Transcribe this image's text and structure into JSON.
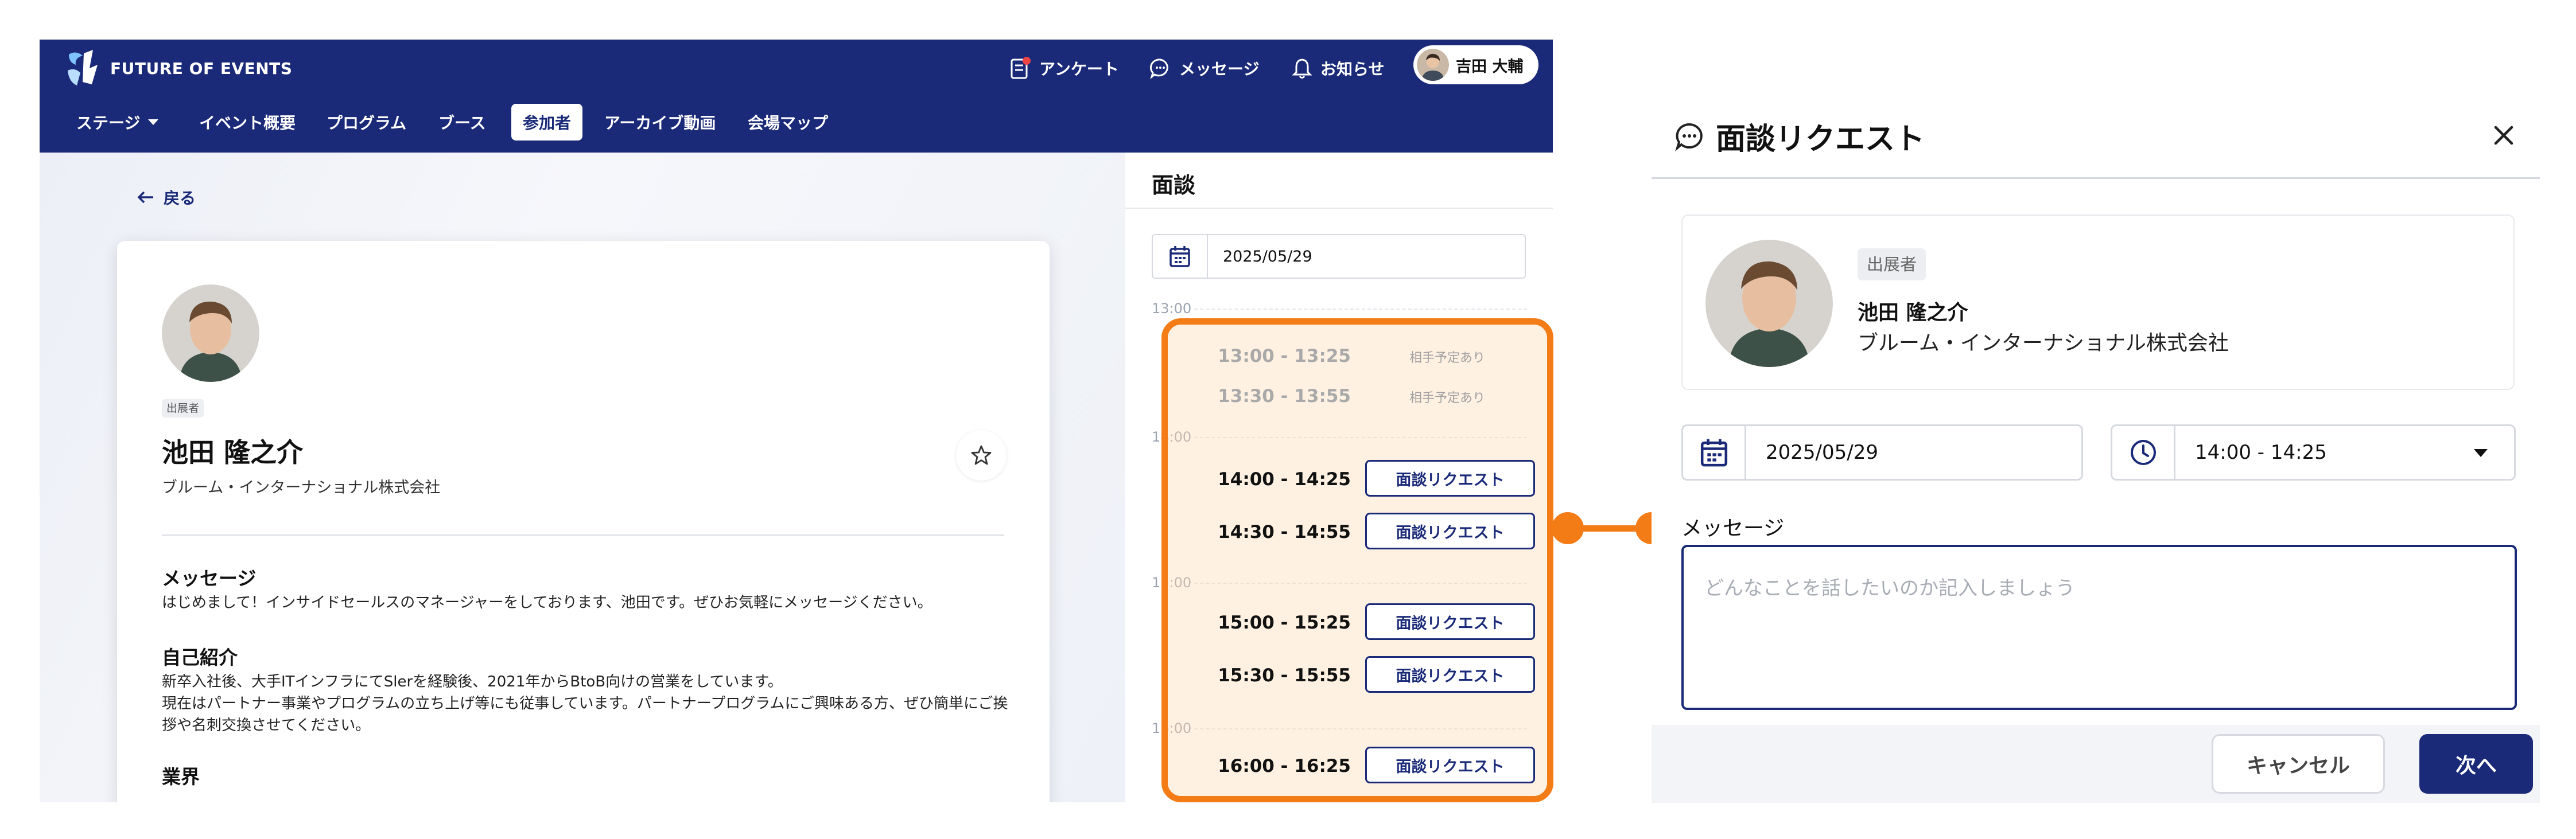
{
  "colors": {
    "primary": "#1a2a78",
    "highlight": "#f47c16",
    "notification": "#ef4444"
  },
  "header": {
    "brand": "FUTURE OF EVENTS",
    "survey": "アンケート",
    "messages": "メッセージ",
    "notifications": "お知らせ",
    "user_name": "吉田 大輔"
  },
  "nav": {
    "items": [
      {
        "label": "ステージ"
      },
      {
        "label": "イベント概要"
      },
      {
        "label": "プログラム"
      },
      {
        "label": "ブース"
      },
      {
        "label": "参加者"
      },
      {
        "label": "アーカイブ動画"
      },
      {
        "label": "会場マップ"
      }
    ],
    "active": "参加者"
  },
  "profile": {
    "back": "戻る",
    "badge": "出展者",
    "name": "池田 隆之介",
    "company": "ブルーム・インターナショナル株式会社",
    "message_heading": "メッセージ",
    "message_text": "はじめまして！インサイドセールスのマネージャーをしております、池田です。ぜひお気軽にメッセージください。",
    "intro_heading": "自己紹介",
    "intro_line1": "新卒入社後、大手ITインフラにてSlerを経験後、2021年からBtoB向けの営業をしています。",
    "intro_line2": "現在はパートナー事業やプログラムの立ち上げ等にも従事しています。パートナープログラムにご興味ある方、ぜひ簡単にご挨拶や名刺交換させてください。",
    "industry_heading": "業界"
  },
  "schedule": {
    "title": "面談",
    "date": "2025/05/29",
    "hours": [
      "13:00",
      "14:00",
      "15:00",
      "16:00"
    ],
    "slots": [
      {
        "time": "13:00 - 13:25",
        "status": "相手予定あり"
      },
      {
        "time": "13:30 - 13:55",
        "status": "相手予定あり"
      },
      {
        "time": "14:00 - 14:25",
        "button": "面談リクエスト"
      },
      {
        "time": "14:30 - 14:55",
        "button": "面談リクエスト"
      },
      {
        "time": "15:00 - 15:25",
        "button": "面談リクエスト"
      },
      {
        "time": "15:30 - 15:55",
        "button": "面談リクエスト"
      },
      {
        "time": "16:00 - 16:25",
        "button": "面談リクエスト"
      }
    ]
  },
  "modal": {
    "title": "面談リクエスト",
    "badge": "出展者",
    "name": "池田 隆之介",
    "company": "ブルーム・インターナショナル株式会社",
    "date": "2025/05/29",
    "time": "14:00 - 14:25",
    "message_label": "メッセージ",
    "message_placeholder": "どんなことを話したいのか記入しましょう",
    "cancel": "キャンセル",
    "next": "次へ"
  }
}
